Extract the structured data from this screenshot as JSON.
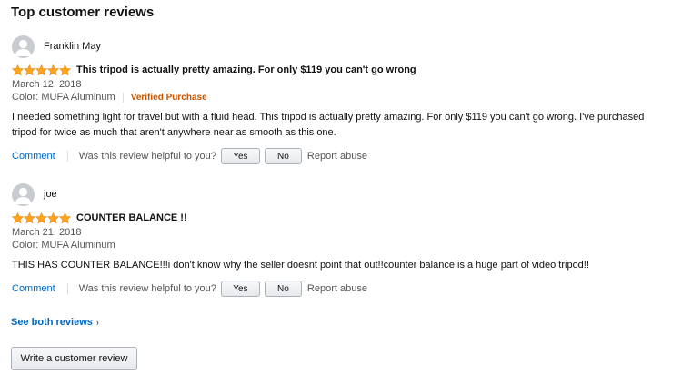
{
  "section": {
    "title": "Top customer reviews"
  },
  "reviews": [
    {
      "author": "Franklin May",
      "stars": 5,
      "title": "This tripod is actually pretty amazing. For only $119 you can't go wrong",
      "date": "March 12, 2018",
      "format": "Color: MUFA Aluminum",
      "verified": "Verified Purchase",
      "body": "I needed something light for travel but with a fluid head. This tripod is actually pretty amazing. For only $119 you can't go wrong. I've purchased tripod for twice as much that aren't anywhere near as smooth as this one.",
      "comment_label": "Comment",
      "helpful_prompt": "Was this review helpful to you?",
      "yes_label": "Yes",
      "no_label": "No",
      "report_label": "Report abuse"
    },
    {
      "author": "joe",
      "stars": 5,
      "title": "COUNTER BALANCE !!",
      "date": "March 21, 2018",
      "format": "Color: MUFA Aluminum",
      "verified": "",
      "body": "THIS HAS COUNTER BALANCE!!!i don't know why the seller doesnt point that out!!counter balance is a huge part of video tripod!!",
      "comment_label": "Comment",
      "helpful_prompt": "Was this review helpful to you?",
      "yes_label": "Yes",
      "no_label": "No",
      "report_label": "Report abuse"
    }
  ],
  "footer": {
    "see_all_label": "See both reviews",
    "chevron_icon": "chevron-right-icon",
    "write_review_label": "Write a customer review"
  },
  "colors": {
    "star": "#ffa41c",
    "link": "#0066c0",
    "verified": "#c45500"
  },
  "icons": {
    "avatar": "default-user-avatar-icon",
    "star": "star-full-icon"
  }
}
